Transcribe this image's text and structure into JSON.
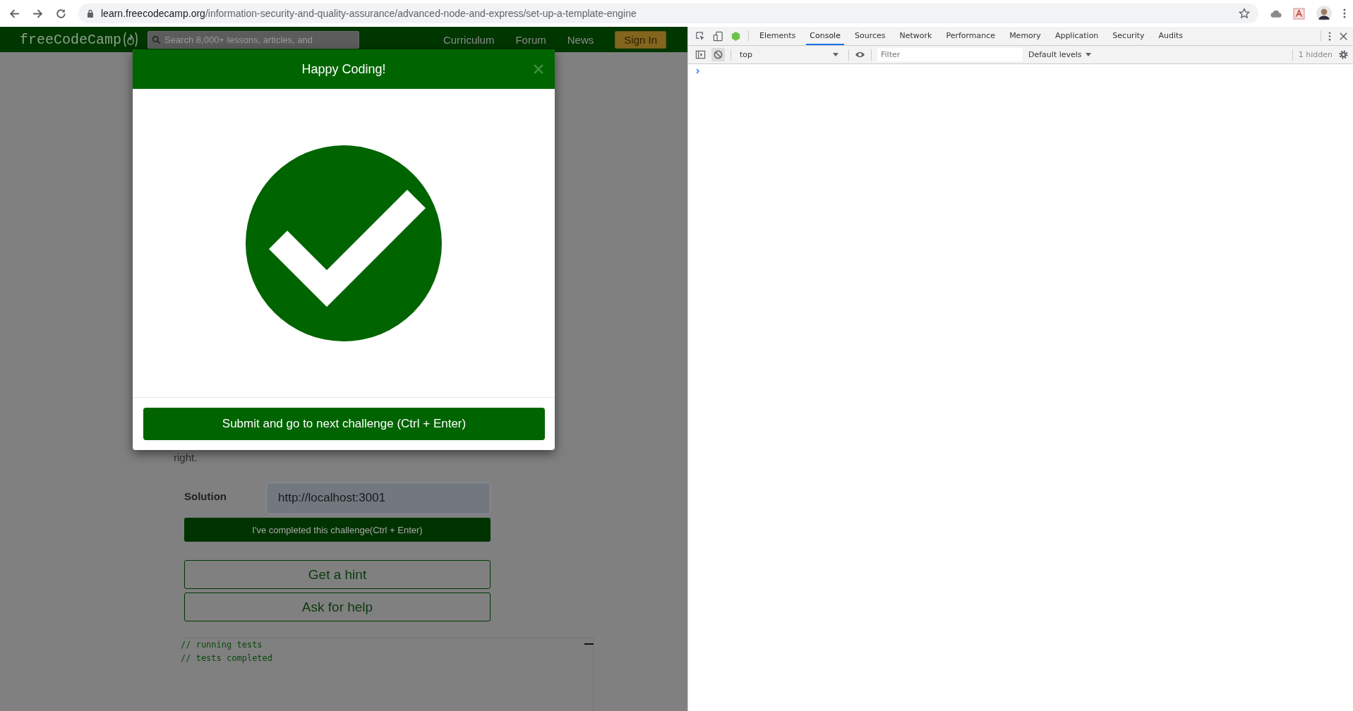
{
  "browser": {
    "url": {
      "host": "learn.freecodecamp.org",
      "path": "/information-security-and-quality-assurance/advanced-node-and-express/set-up-a-template-engine"
    }
  },
  "site": {
    "logo": "freeCodeCamp",
    "search": {
      "placeholder": "Search 8,000+ lessons, articles, and"
    },
    "nav": [
      "Curriculum",
      "Forum",
      "News"
    ],
    "sign_in": "Sign In"
  },
  "page": {
    "paragraph_end": "right.",
    "solution": {
      "label": "Solution",
      "value": "http://localhost:3001"
    },
    "complete_button": "I've completed this challenge(Ctrl + Enter)",
    "hint_button": "Get a hint",
    "help_button": "Ask for help",
    "console_lines": [
      "// running tests",
      "// tests completed"
    ]
  },
  "modal": {
    "title": "Happy Coding!",
    "submit_button": "Submit and go to next challenge (Ctrl + Enter)"
  },
  "devtools": {
    "tabs": [
      {
        "label": "Elements",
        "selected": false
      },
      {
        "label": "Console",
        "selected": true
      },
      {
        "label": "Sources",
        "selected": false
      },
      {
        "label": "Network",
        "selected": false
      },
      {
        "label": "Performance",
        "selected": false
      },
      {
        "label": "Memory",
        "selected": false
      },
      {
        "label": "Application",
        "selected": false
      },
      {
        "label": "Security",
        "selected": false
      },
      {
        "label": "Audits",
        "selected": false
      }
    ],
    "context": "top",
    "filter": {
      "placeholder": "Filter"
    },
    "levels": "Default levels",
    "hidden_count": "1 hidden"
  }
}
